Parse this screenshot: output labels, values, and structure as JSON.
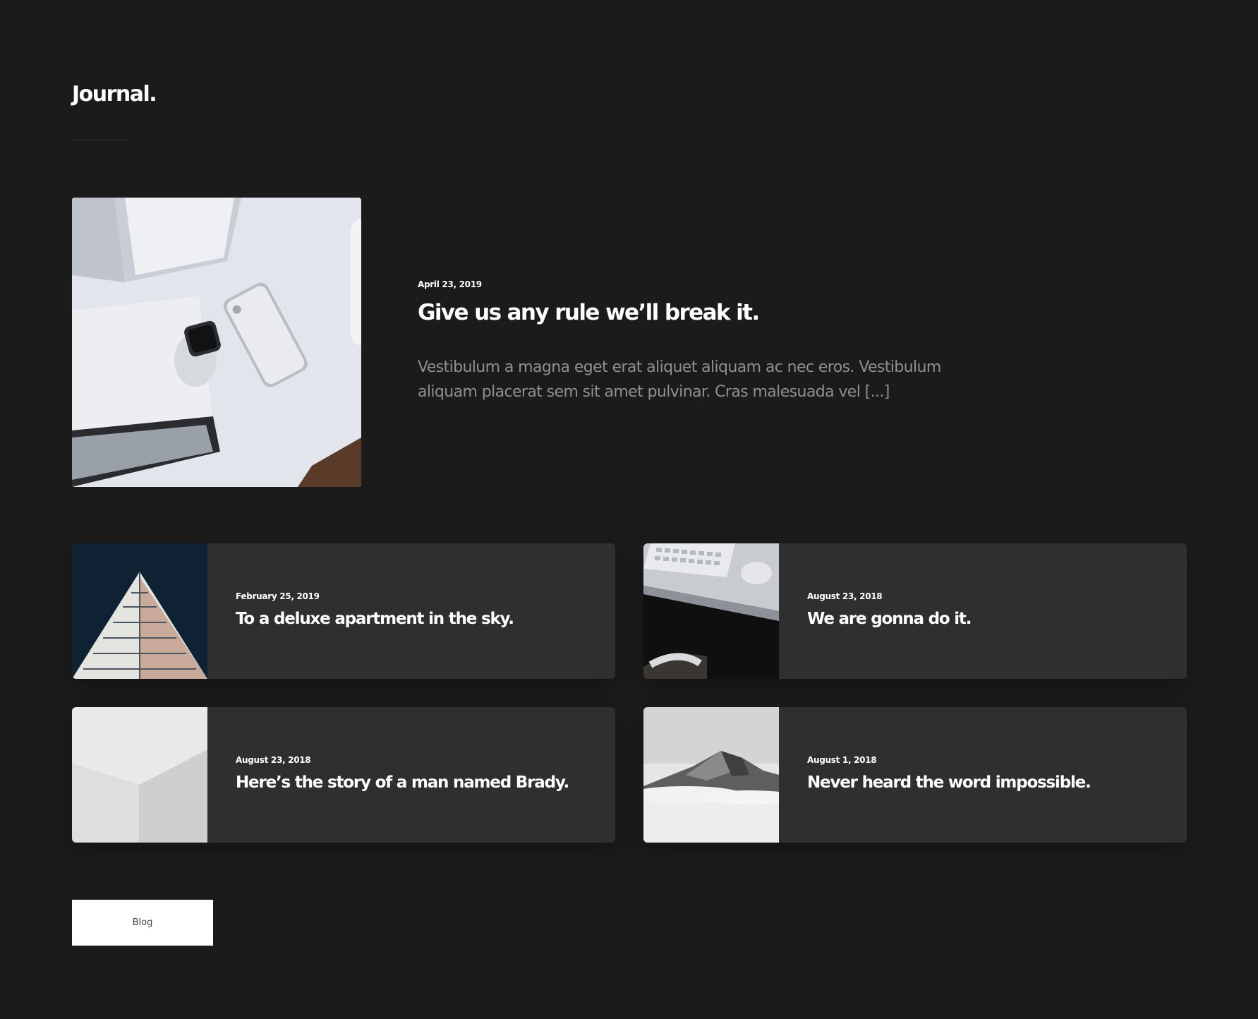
{
  "section": {
    "title": "Journal."
  },
  "featured": {
    "date": "April 23, 2019",
    "title": "Give us any rule we’ll break it.",
    "excerpt": "Vestibulum a magna eget erat aliquet aliquam ac nec eros. Vestibulum aliquam placerat sem sit amet pulvinar. Cras malesuada vel [...]"
  },
  "posts": [
    {
      "date": "February 25, 2019",
      "title": "To a deluxe apartment in the sky."
    },
    {
      "date": "August 23, 2018",
      "title": "We are gonna do it."
    },
    {
      "date": "August 23, 2018",
      "title": "Here’s the story of a man named Brady."
    },
    {
      "date": "August 1, 2018",
      "title": "Never heard the word impossible."
    }
  ],
  "blog_button": {
    "label": "Blog"
  },
  "colors": {
    "background": "#1b1b1b",
    "card": "#2f2f2f",
    "excerpt_text": "#8f8f8f",
    "button_background": "#ffffff"
  }
}
